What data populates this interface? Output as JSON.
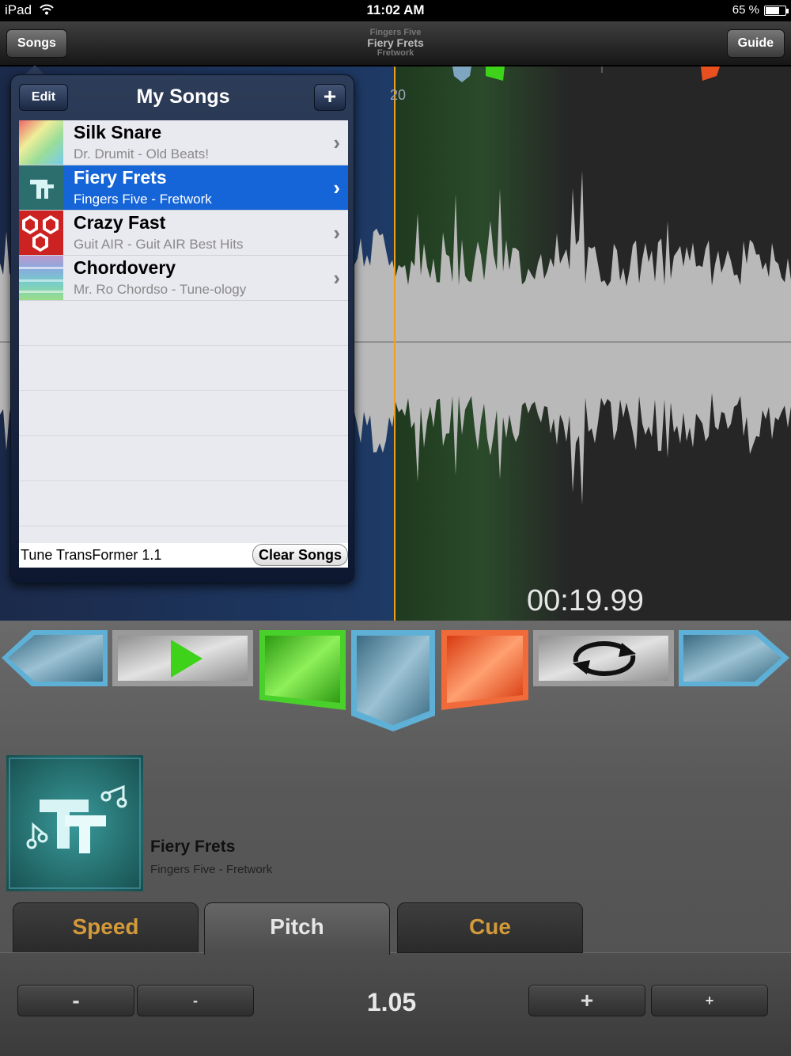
{
  "status_bar": {
    "carrier": "iPad",
    "time": "11:02 AM",
    "battery_percent": "65 %",
    "battery_level": 0.65
  },
  "nav": {
    "songs_button": "Songs",
    "guide_button": "Guide",
    "artist": "Fingers Five",
    "song": "Fiery Frets",
    "album": "Fretwork"
  },
  "waveform": {
    "marker_label": "20",
    "time": "00:19.99"
  },
  "songs_popover": {
    "title": "My Songs",
    "edit_button": "Edit",
    "add_button": "+",
    "songs": [
      {
        "name": "Silk Snare",
        "subtitle": "Dr. Drumit - Old Beats!",
        "selected": false
      },
      {
        "name": "Fiery Frets",
        "subtitle": "Fingers Five - Fretwork",
        "selected": true
      },
      {
        "name": "Crazy Fast",
        "subtitle": "Guit AIR - Guit AIR Best Hits",
        "selected": false
      },
      {
        "name": "Chordovery",
        "subtitle": "Mr. Ro Chordso - Tune-ology",
        "selected": false
      }
    ],
    "app_version": "Tune TransFormer  1.1",
    "clear_button": "Clear Songs"
  },
  "transport": {
    "buttons": [
      "previous",
      "play",
      "green-cue",
      "blue-cue",
      "red-cue",
      "loop",
      "next"
    ],
    "colors": {
      "play": "#3fd21a",
      "green": "#3fb81e",
      "blue": "#4d7f97",
      "red": "#ee4a16"
    }
  },
  "now_playing": {
    "song": "Fiery Frets",
    "subtitle": "Fingers Five - Fretwork"
  },
  "tabs": [
    {
      "label": "Speed",
      "active": false
    },
    {
      "label": "Pitch",
      "active": true
    },
    {
      "label": "Cue",
      "active": false
    }
  ],
  "pitch": {
    "value": "1.05",
    "dec_large": "-",
    "dec_small": "-",
    "inc_large": "+",
    "inc_small": "+"
  }
}
